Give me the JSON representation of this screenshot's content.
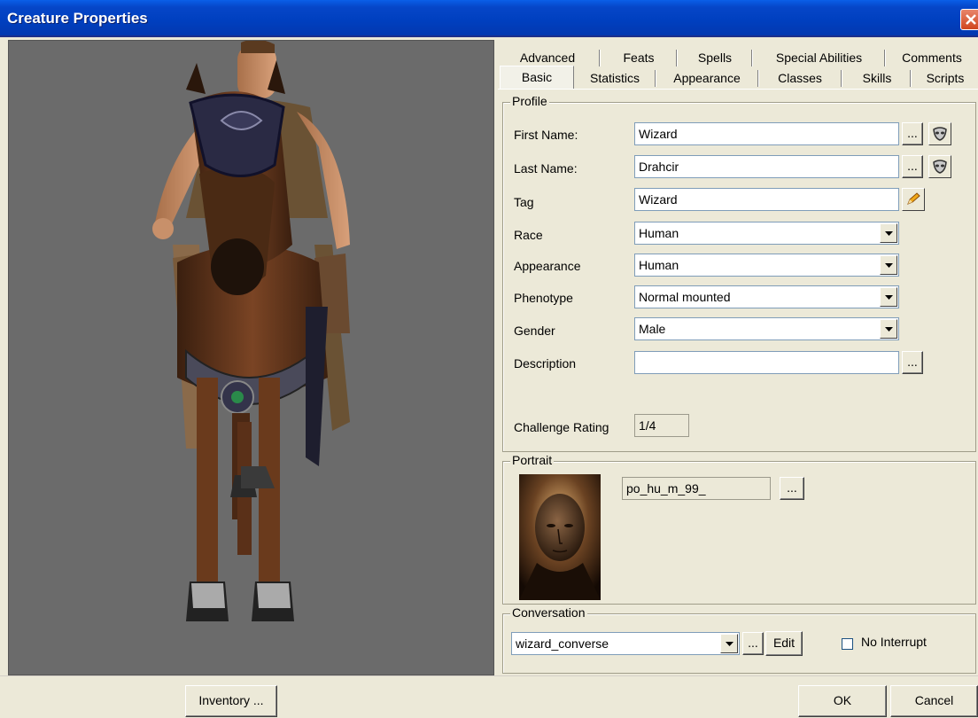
{
  "window": {
    "title": "Creature Properties"
  },
  "tabs": {
    "row1": [
      "Advanced",
      "Feats",
      "Spells",
      "Special Abilities",
      "Comments"
    ],
    "row2": [
      "Basic",
      "Statistics",
      "Appearance",
      "Classes",
      "Skills",
      "Scripts"
    ],
    "active": "Basic"
  },
  "profile": {
    "group_label": "Profile",
    "first_name_label": "First Name:",
    "first_name_value": "Wizard",
    "last_name_label": "Last Name:",
    "last_name_value": "Drahcir",
    "tag_label": "Tag",
    "tag_value": "Wizard",
    "race_label": "Race",
    "race_value": "Human",
    "appearance_label": "Appearance",
    "appearance_value": "Human",
    "phenotype_label": "Phenotype",
    "phenotype_value": "Normal mounted",
    "gender_label": "Gender",
    "gender_value": "Male",
    "description_label": "Description",
    "description_value": "",
    "challenge_label": "Challenge Rating",
    "challenge_value": "1/4"
  },
  "portrait": {
    "group_label": "Portrait",
    "value": "po_hu_m_99_"
  },
  "conversation": {
    "group_label": "Conversation",
    "value": "wizard_converse",
    "edit_label": "Edit",
    "no_interrupt_label": "No Interrupt",
    "no_interrupt_checked": false
  },
  "buttons": {
    "browse": "...",
    "inventory": "Inventory ...",
    "ok": "OK",
    "cancel": "Cancel"
  },
  "icons": {
    "close": "close-icon",
    "mask": "mask-icon",
    "tag_generate": "pencil-icon",
    "dropdown": "chevron-down-icon"
  },
  "colors": {
    "titlebar": "#0040c0",
    "dialog_bg": "#ece9d8",
    "viewport_bg": "#6b6b6b",
    "close_btn": "#d0461f"
  }
}
